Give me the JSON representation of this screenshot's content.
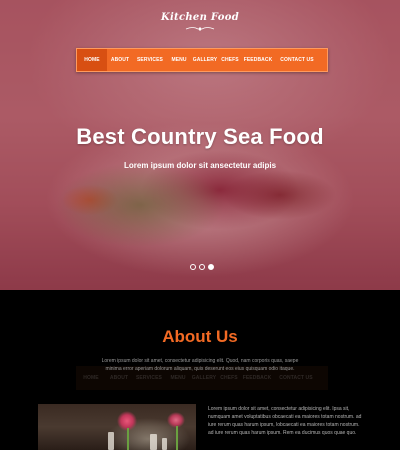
{
  "brand": {
    "logo": "Kitchen Food"
  },
  "nav": {
    "items": [
      {
        "label": "HOME",
        "active": true
      },
      {
        "label": "ABOUT"
      },
      {
        "label": "SERVICES"
      },
      {
        "label": "MENU"
      },
      {
        "label": "GALLERY"
      },
      {
        "label": "CHEFS"
      },
      {
        "label": "FEEDBACK"
      },
      {
        "label": "CONTACT US"
      }
    ]
  },
  "hero": {
    "title": "Best Country Sea Food",
    "subtitle": "Lorem ipsum dolor sit ansectetur adipis",
    "slides": 3,
    "active_slide": 3
  },
  "about": {
    "title": "About Us",
    "intro": "Lorem ipsum dolor sit amet, consectetur adipisicing elit. Quod, nam corporis quas, saepe minima error aperiam dolorum aliquam, quis deserunt eos eius quisquam odio itaque.",
    "paragraph": "Lorem ipsum dolor sit amet, consectetur adipisicing elit. Ipsa sit, numquam amet voluptatibus obcaecati ea maiores totam nostrum. ad iure rerum quas harum ipsum, lobcaecati ea maiores totam nostrum. ad iure rerum quas harum ipsum. Rem ea ducimus quos quae quo."
  },
  "colors": {
    "accent": "#f26a24",
    "accent_dark": "#d84f12",
    "background": "#000000"
  }
}
